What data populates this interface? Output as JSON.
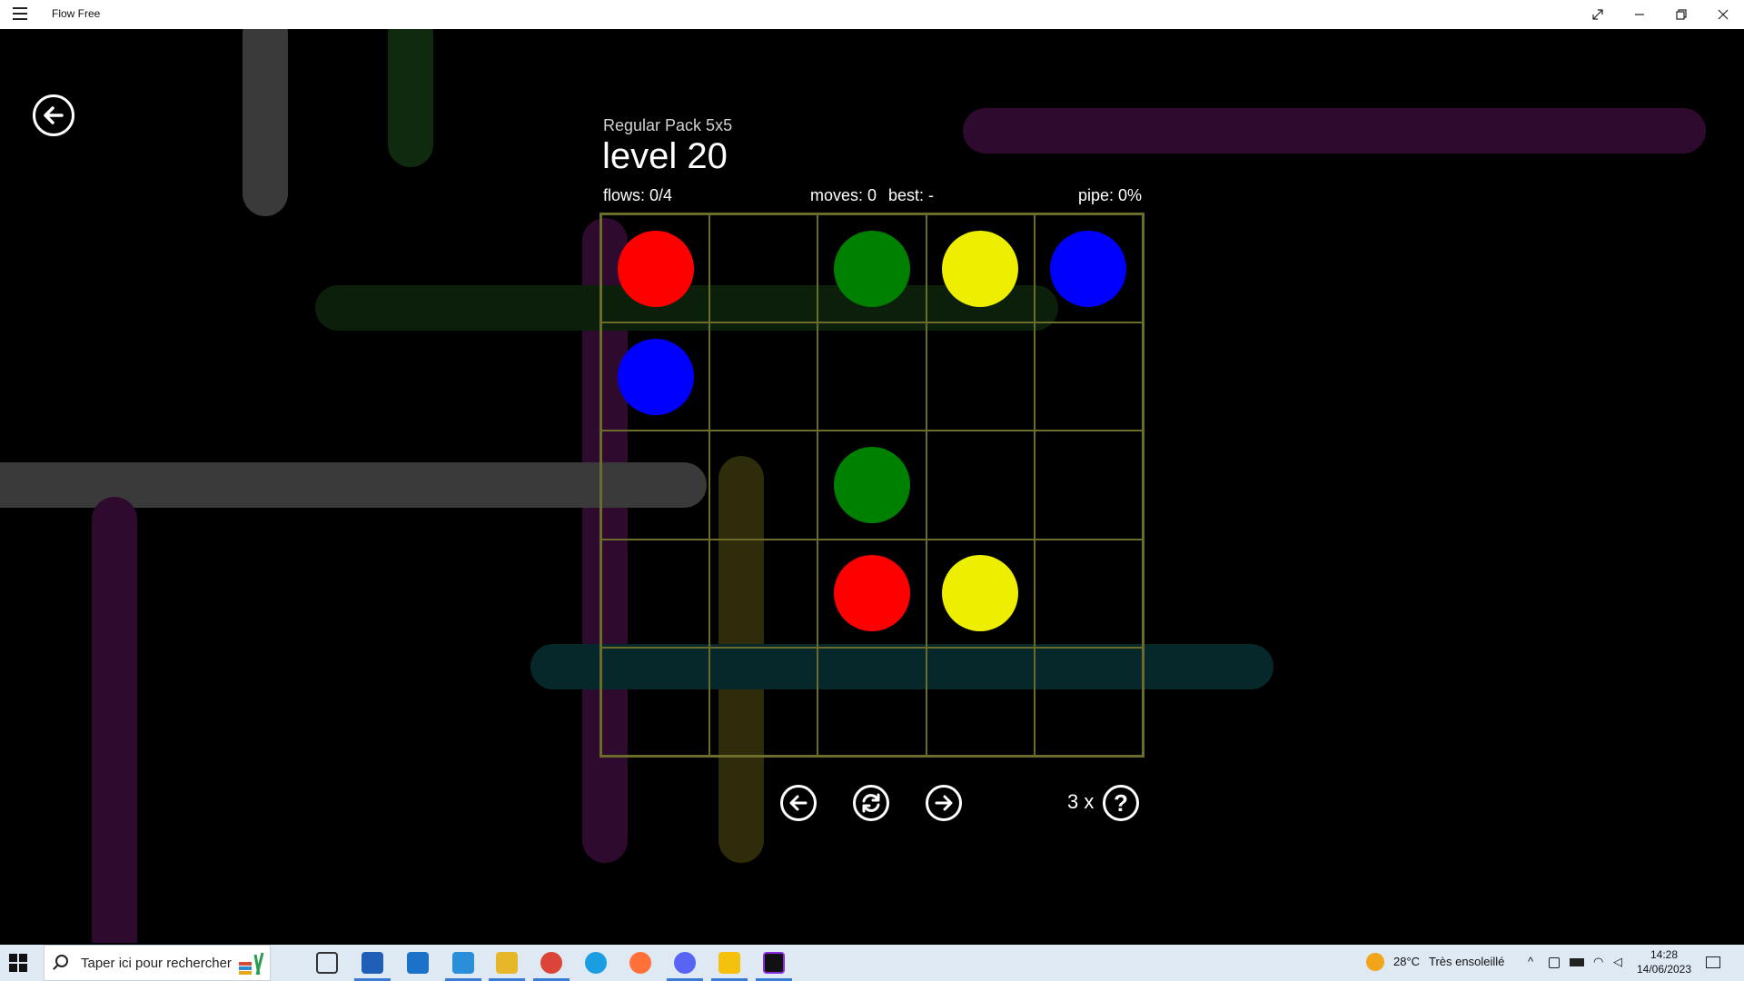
{
  "window": {
    "title": "Flow Free",
    "buttons": [
      "fullscreen",
      "minimize",
      "restore",
      "close"
    ]
  },
  "game": {
    "pack_name": "Regular Pack 5x5",
    "level_title": "level 20",
    "flows_text": "flows: 0/4",
    "moves_text": "moves: 0",
    "best_text": "best: -",
    "pipe_text": "pipe: 0%",
    "hints_count": "3 x",
    "hint_symbol": "?",
    "board": {
      "rows": 5,
      "cols": 5,
      "grid": [
        [
          "red",
          "",
          "green",
          "yellow",
          "blue"
        ],
        [
          "blue",
          "",
          "",
          "",
          ""
        ],
        [
          "",
          "",
          "green",
          "",
          ""
        ],
        [
          "",
          "",
          "red",
          "yellow",
          ""
        ],
        [
          "",
          "",
          "",
          "",
          ""
        ]
      ]
    },
    "colors": {
      "red": "#ff0000",
      "green": "#008000",
      "yellow": "#eeee00",
      "blue": "#0000ff",
      "grid_line": "#6b6b2a"
    },
    "controls": [
      "previous-level",
      "restart",
      "next-level"
    ]
  },
  "taskbar": {
    "search_placeholder": "Taper ici pour rechercher",
    "weather_temp": "28°C",
    "weather_desc": "Très ensoleillé",
    "time": "14:28",
    "date": "14/06/2023",
    "apps": [
      "task-view",
      "store",
      "mail",
      "vscode",
      "file-explorer",
      "chrome",
      "edge",
      "firefox",
      "discord",
      "maps",
      "flow-free"
    ]
  }
}
